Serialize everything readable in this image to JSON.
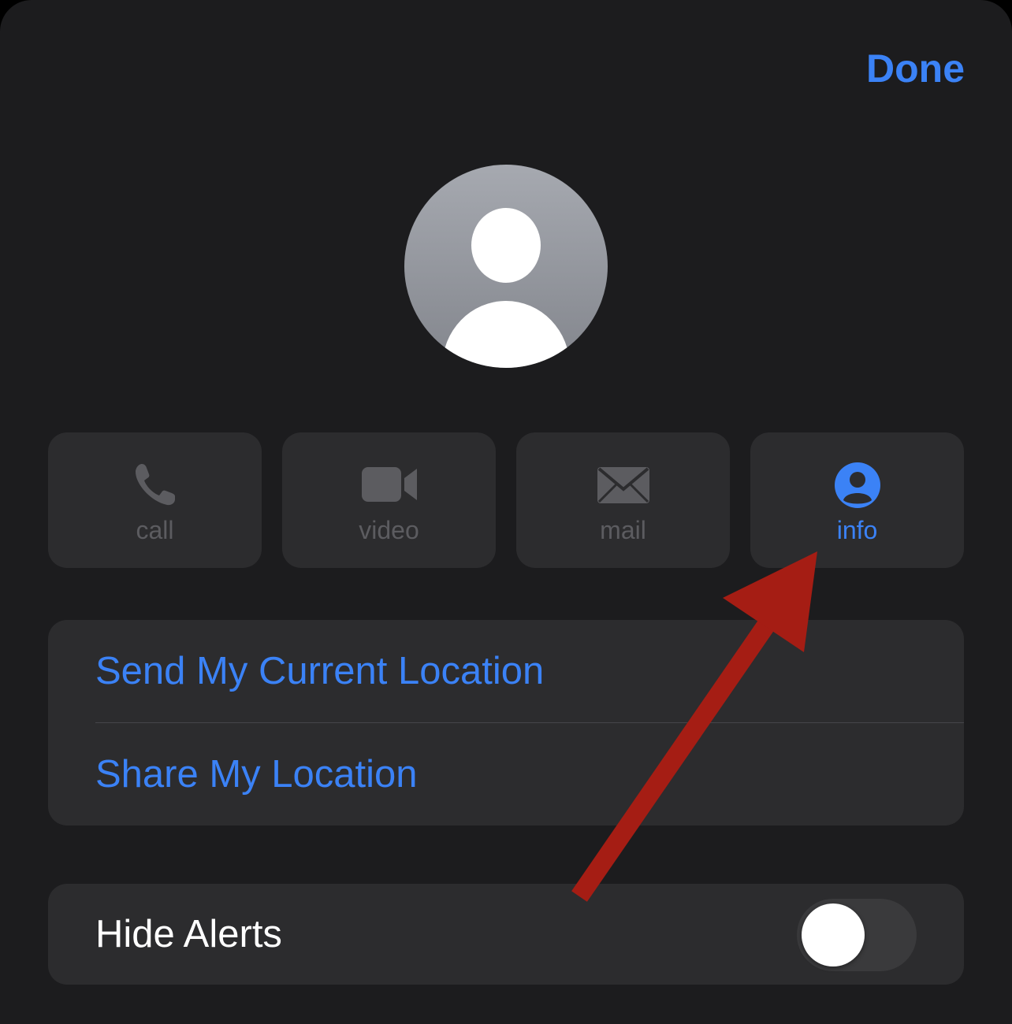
{
  "header": {
    "done_label": "Done"
  },
  "contact": {
    "avatar_icon": "person-placeholder-icon"
  },
  "actions": [
    {
      "label": "call",
      "icon": "phone-icon",
      "enabled": false
    },
    {
      "label": "video",
      "icon": "video-camera-icon",
      "enabled": false
    },
    {
      "label": "mail",
      "icon": "envelope-icon",
      "enabled": false
    },
    {
      "label": "info",
      "icon": "person-circle-icon",
      "enabled": true
    }
  ],
  "location": {
    "send_current": "Send My Current Location",
    "share": "Share My Location"
  },
  "alerts": {
    "hide_alerts_label": "Hide Alerts",
    "hide_alerts_on": false
  },
  "annotation": {
    "arrow_color": "#a51d14",
    "points_to": "info"
  },
  "colors": {
    "accent": "#3b82f6",
    "background": "#1c1c1e",
    "card": "#2c2c2e",
    "disabled_text": "#5c5c60"
  }
}
